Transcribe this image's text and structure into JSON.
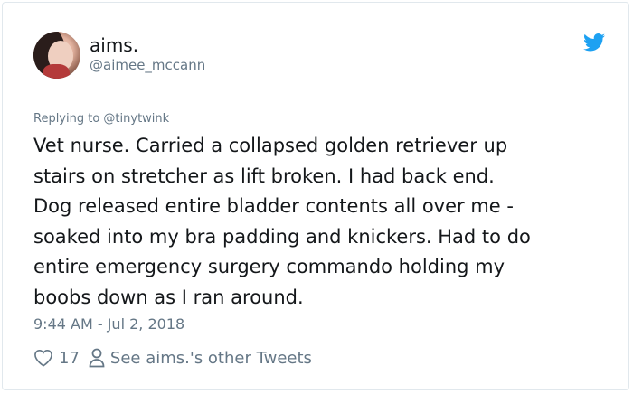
{
  "tweet": {
    "author_name": "aims.",
    "author_handle": "@aimee_mccann",
    "replying_to": "Replying to @tinytwink",
    "text": "Vet nurse. Carried a collapsed golden retriever up\nstairs on stretcher as lift broken. I had back end.\nDog released entire bladder contents all over me -\nsoaked into my bra padding and knickers. Had to do\nentire emergency surgery commando holding my\nboobs down as I ran around.",
    "timestamp": "9:44 AM - Jul 2, 2018",
    "like_count": "17",
    "other_tweets_label": "See aims.'s other Tweets"
  },
  "icons": {
    "brand": "twitter-bird-icon",
    "like": "heart-icon",
    "profile": "person-icon"
  },
  "colors": {
    "twitter_blue": "#1da1f2",
    "secondary_text": "#657786",
    "primary_text": "#14171a"
  }
}
